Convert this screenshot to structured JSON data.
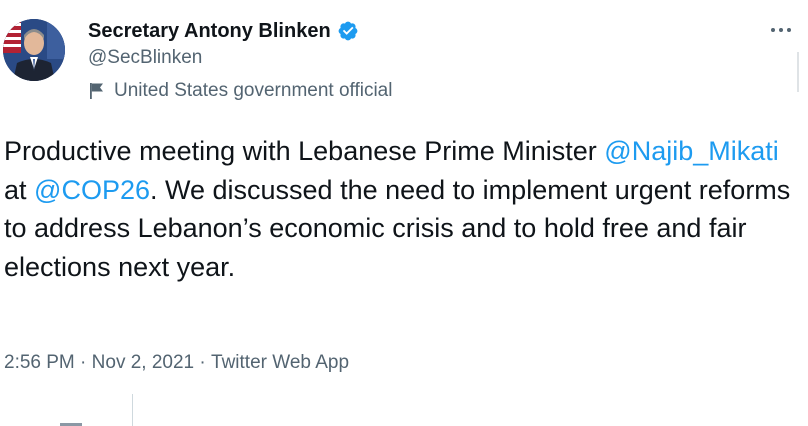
{
  "author": {
    "display_name": "Secretary Antony Blinken",
    "handle": "@SecBlinken",
    "label": "United States government official"
  },
  "tweet": {
    "text_part1": "Productive meeting with Lebanese Prime Minister ",
    "mention1": "@Najib_Mikati",
    "text_part2": " at ",
    "mention2": "@COP26",
    "text_part3": ". We discussed the need to implement urgent reforms to address Lebanon’s economic crisis and to hold free and fair elections next year."
  },
  "meta": {
    "time": "2:56 PM",
    "separator": " · ",
    "date": "Nov 2, 2021",
    "source": "Twitter Web App"
  },
  "colors": {
    "link": "#1d9bf0",
    "secondary_text": "#536471",
    "verified_badge": "#1d9bf0"
  },
  "icons": {
    "verified": "verified-badge-icon",
    "label": "flag-icon",
    "more": "more-options-icon"
  }
}
